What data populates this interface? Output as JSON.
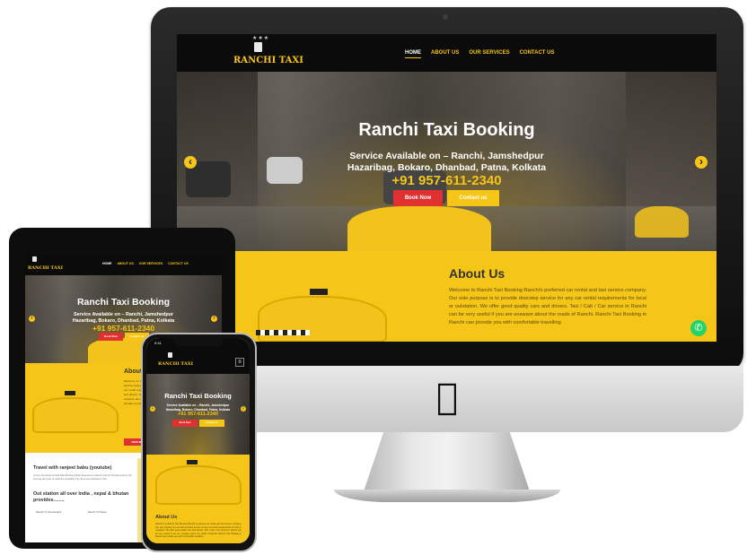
{
  "brand": {
    "name": "RANCHI TAXI",
    "stars": "★★★",
    "yellow": "#f5c518",
    "red": "#e03030"
  },
  "nav": {
    "items": [
      "HOME",
      "ABOUT US",
      "OUR SERVICES",
      "CONTACT US"
    ],
    "active": "HOME"
  },
  "hero": {
    "title": "Ranchi Taxi Booking",
    "service_line1": "Service Available on – Ranchi, Jamshedpur",
    "service_line2": "Hazaribag, Bokaro, Dhanbad, Patna, Kolkata",
    "phone": "+91 957-611-2340",
    "book_label": "Book Now",
    "contact_label": "Contact us",
    "prev_icon": "‹",
    "next_icon": "›"
  },
  "about": {
    "heading": "About Us",
    "text": "Welcome to Ranchi Taxi Booking Ranchi's preferred car rental and taxi service company. Our sole purpose is to provide doorstep service for any car rental requirements for local or outstation. We offer good quality cars and drivers. Taxi / Cab / Car service in Ranchi can be very useful if you are unaware about the roads of Ranchi. Ranchi Taxi Booking in Ranchi can provide you with comfortable travelling"
  },
  "tablet": {
    "view_more": "VIEW MORE",
    "youtube_title": "Travel with ranjeet babu (youtube)",
    "youtube_text": "Lorem Taxi Experiential Ride Booking Ride Experience Ranchi Family friendly assure the provide all types of vehicles available City Secured Outstation Taxi",
    "outstation_title": "Out station all over India , nepal & bhutan provides........",
    "link1": "Ranchi To Jamshedpur",
    "link2": "Ranchi To Patna"
  },
  "phone": {
    "time": "9:41",
    "menu_icon": "≡"
  },
  "whatsapp_icon": "✆"
}
